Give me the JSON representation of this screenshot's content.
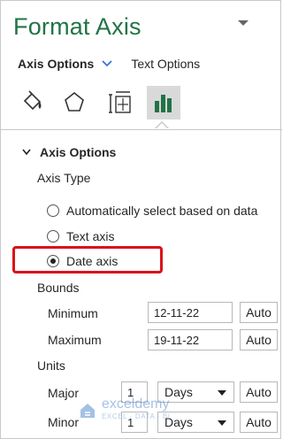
{
  "pane": {
    "title": "Format Axis"
  },
  "tabs": {
    "active": "Axis Options",
    "other": "Text Options"
  },
  "icons": [
    "fill-line-icon",
    "effects-icon",
    "size-properties-icon",
    "axis-options-chart-icon"
  ],
  "section": {
    "label": "Axis Options"
  },
  "axis_type": {
    "label": "Axis Type",
    "options": [
      {
        "label": "Automatically select based on data",
        "selected": false
      },
      {
        "label": "Text axis",
        "selected": false
      },
      {
        "label": "Date axis",
        "selected": true
      }
    ]
  },
  "bounds": {
    "label": "Bounds",
    "minimum": {
      "label": "Minimum",
      "value": "12-11-22",
      "auto": "Auto"
    },
    "maximum": {
      "label": "Maximum",
      "value": "19-11-22",
      "auto": "Auto"
    }
  },
  "units": {
    "label": "Units",
    "major": {
      "label": "Major",
      "value": "1",
      "unit": "Days",
      "auto": "Auto"
    },
    "minor": {
      "label": "Minor",
      "value": "1",
      "unit": "Days",
      "auto": "Auto"
    }
  },
  "watermark": {
    "name": "exceldemy",
    "tagline": "EXCEL · DATA · BI"
  },
  "colors": {
    "title": "#217346",
    "highlight": "#d9121a",
    "selected_icon_bg": "#d9d9d9"
  }
}
